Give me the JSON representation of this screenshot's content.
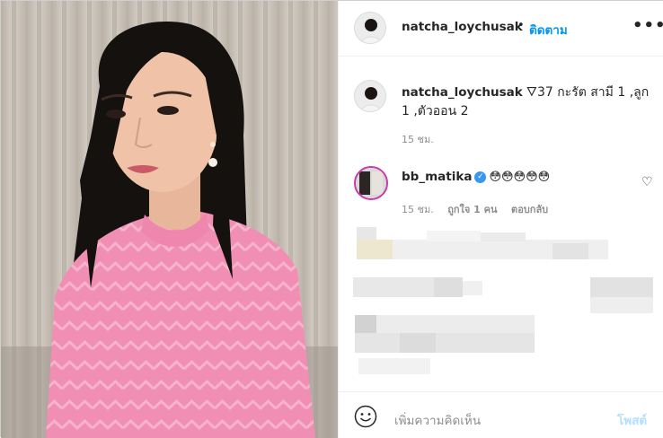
{
  "post": {
    "username": "natcha_loychusak",
    "separator": "•",
    "follow_label": "ติดตาม",
    "more_label": "•••"
  },
  "caption": {
    "username": "natcha_loychusak",
    "text": "🜄37 กะรัต สามี 1 ,ลูก 1 ,ตัวออน 2",
    "time": "15 ชม."
  },
  "comment": {
    "username": "bb_matika",
    "verified_mark": "✓",
    "text": "😳😳😳😳😳",
    "time": "15 ชม.",
    "likes": "ถูกใจ 1 คน",
    "reply_label": "ตอบกลับ",
    "like_icon": "heart-icon"
  },
  "composer": {
    "placeholder": "เพิ่มความคิดเห็น",
    "post_label": "โพสต์"
  },
  "colors": {
    "accent": "#0095f6",
    "post_disabled": "#b2dffc",
    "muted": "#8e8e8e",
    "story_ring": "#c837ab"
  }
}
